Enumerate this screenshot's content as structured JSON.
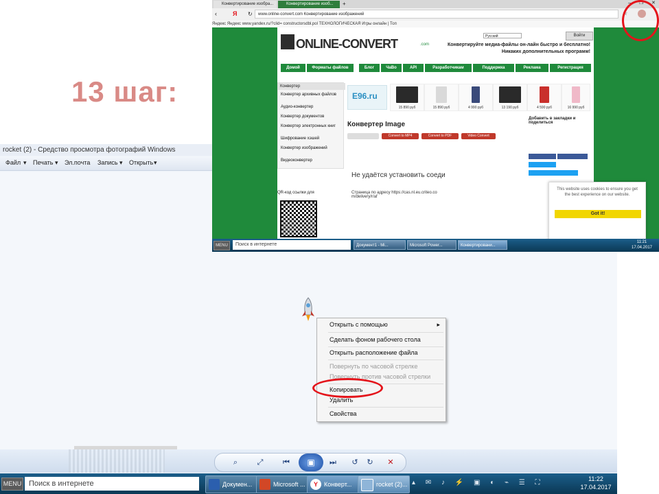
{
  "step_title": "13 шаг:",
  "viewer": {
    "title": "rocket (2) - Средство просмотра фотографий Windows",
    "menu": [
      "Файл",
      "Печать",
      "Эл.почта",
      "Запись",
      "Открыть"
    ]
  },
  "context_menu": {
    "items": [
      {
        "label": "Открыть с помощью",
        "disabled": false
      },
      {
        "label": "Сделать фоном рабочего стола",
        "disabled": false
      },
      {
        "label": "Открыть расположение файла",
        "disabled": false
      },
      {
        "label": "Повернуть по часовой стрелке",
        "disabled": true
      },
      {
        "label": "Повернуть против часовой стрелки",
        "disabled": true
      },
      {
        "label": "Копировать",
        "disabled": false
      },
      {
        "label": "Удалить",
        "disabled": false
      },
      {
        "label": "Свойства",
        "disabled": false
      }
    ]
  },
  "taskbar": {
    "menu": "MENU",
    "search": "Поиск в интернете",
    "tasks": [
      "Докумен...",
      "Microsoft ...",
      "Конверт...",
      "rocket (2)..."
    ],
    "time": "11:22",
    "date": "17.04.2017"
  },
  "browser": {
    "tabs": [
      "Конвертирование изобра...",
      "Конвертирование изоб..."
    ],
    "url": "www.online-convert.com",
    "page_title": "Конвертирование изображений",
    "bookmarks": "Яндекс   Яндекс   www.yandex.ru/?clid=   constructorsdbl.pol   ТЕХНОЛОГИЧЕСКАЯ   Игры онлайн | Топ",
    "logo": "ONLINE-CONVERT",
    "logo_suffix": ".com",
    "tagline_1": "Конвертируйте медиа-файлы он-лайн быстро и бесплатно!",
    "tagline_2": "Никаких дополнительных программ!",
    "login": "Войти",
    "lang": "Русский",
    "nav": [
      "Домой",
      "Форматы файлов",
      "Блог",
      "ЧаВо",
      "API",
      "Разработчикам",
      "Поддержка",
      "Реклама",
      "Регистрация"
    ],
    "sidebar_heading": "Конвертер",
    "sidebar": [
      "Конвертер архивных файлов",
      "Аудио-конвертер",
      "Конвертер документов",
      "Конвертер электронных книг",
      "Шифрование хэшей",
      "Конвертер изображений",
      "Видеоконвертер"
    ],
    "qr_label": "QR-код ссылки для",
    "ad_brand": "E96.ru",
    "prices": [
      "15 890 руб",
      "15 890 руб",
      "4 990 руб",
      "13 190 руб",
      "4 590 руб",
      "16 990 руб"
    ],
    "converter_title": "Конвертер Image",
    "pills": [
      "Convert to MP4",
      "Convert to PDF",
      "Video Convert"
    ],
    "error_text": "Не удаётся установить соеди",
    "error_detail": "Страница по адресу https://cas.nl.eu.criteo.com/delivery/r/af",
    "bookmark_title": "Добавить в закладки и поделиться",
    "cookie_text": "This website uses cookies to ensure you get the best experience on our website.",
    "cookie_button": "Got it!",
    "btb_search": "Поиск в интернете",
    "btb_tasks": [
      "Документ1 - Mi...",
      "Microsoft Power...",
      "Конвертировани..."
    ],
    "btb_time": "11:21",
    "btb_date": "17.04.2017"
  },
  "colors": {
    "accent_red": "#e4141b",
    "site_green": "#1f8a3b",
    "title_pink": "#d98a86"
  }
}
